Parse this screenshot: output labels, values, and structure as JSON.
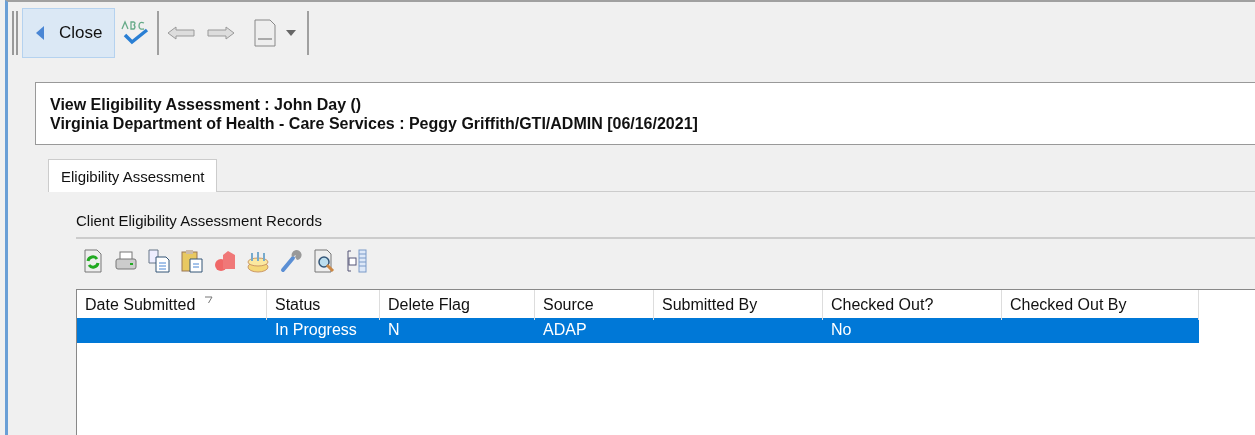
{
  "toolbar": {
    "close_label": "Close"
  },
  "header": {
    "title": "View Eligibility Assessment : John Day ()",
    "subtitle": "Virginia Department of Health - Care Services :  Peggy Griffith/GTI/ADMIN [06/16/2021]"
  },
  "tabs": [
    {
      "label": "Eligibility Assessment",
      "selected": true
    }
  ],
  "section": {
    "title": "Client Eligibility Assessment Records"
  },
  "table": {
    "columns": [
      {
        "label": "Date Submitted",
        "sorted": true
      },
      {
        "label": "Status",
        "sorted": false
      },
      {
        "label": "Delete Flag",
        "sorted": false
      },
      {
        "label": "Source",
        "sorted": false
      },
      {
        "label": "Submitted By",
        "sorted": false
      },
      {
        "label": "Checked Out?",
        "sorted": false
      },
      {
        "label": "Checked Out By",
        "sorted": false
      }
    ],
    "rows": [
      {
        "cells": [
          "",
          "In Progress",
          "N",
          "ADAP",
          "",
          "No",
          ""
        ],
        "selected": true
      }
    ]
  }
}
